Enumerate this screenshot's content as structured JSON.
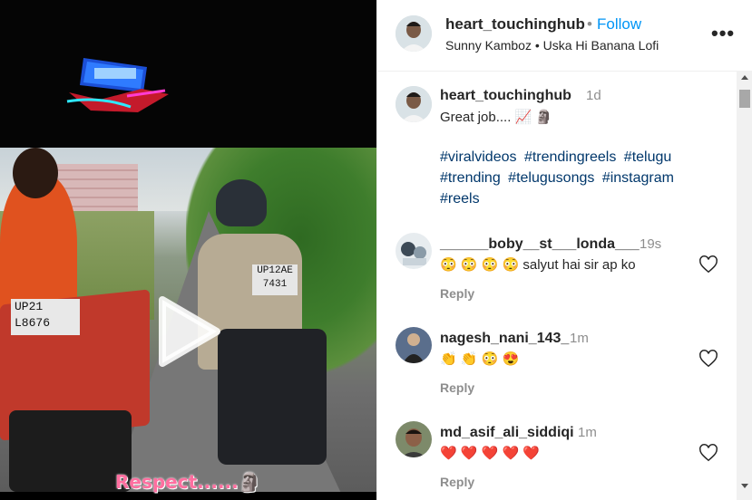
{
  "header": {
    "username": "heart_touchinghub",
    "separator": "•",
    "follow_label": "Follow",
    "audio": "Sunny Kamboz • Uska Hi Banana Lofi",
    "more_label": "•••"
  },
  "media": {
    "caption": "Respect......🗿",
    "plate_left_line1": "UP21",
    "plate_left_line2": "L8676",
    "plate_right_line1": "UP12AE",
    "plate_right_line2": "7431",
    "play_icon": "play-icon"
  },
  "post": {
    "username": "heart_touchinghub",
    "time": "1d",
    "text": "Great job.... 📈 🗿",
    "hashtags": [
      "#viralvideos",
      "#trendingreels",
      "#telugu",
      "#trending",
      "#telugusongs",
      "#instagram",
      "#reels"
    ]
  },
  "comments": [
    {
      "username": "______boby__st___londa___",
      "time": "19s",
      "text": "😳 😳 😳 😳  salyut hai sir ap ko",
      "reply_label": "Reply"
    },
    {
      "username": "nagesh_nani_143_",
      "time": "1m",
      "text": "👏 👏 😳 😍",
      "reply_label": "Reply"
    },
    {
      "username": "md_asif_ali_siddiqi",
      "time": "1m",
      "text": "❤️ ❤️ ❤️ ❤️ ❤️",
      "reply_label": "Reply"
    }
  ],
  "colors": {
    "link_blue": "#0095f6",
    "hashtag": "#00376b",
    "muted": "#8e8e8e",
    "text": "#262626"
  }
}
